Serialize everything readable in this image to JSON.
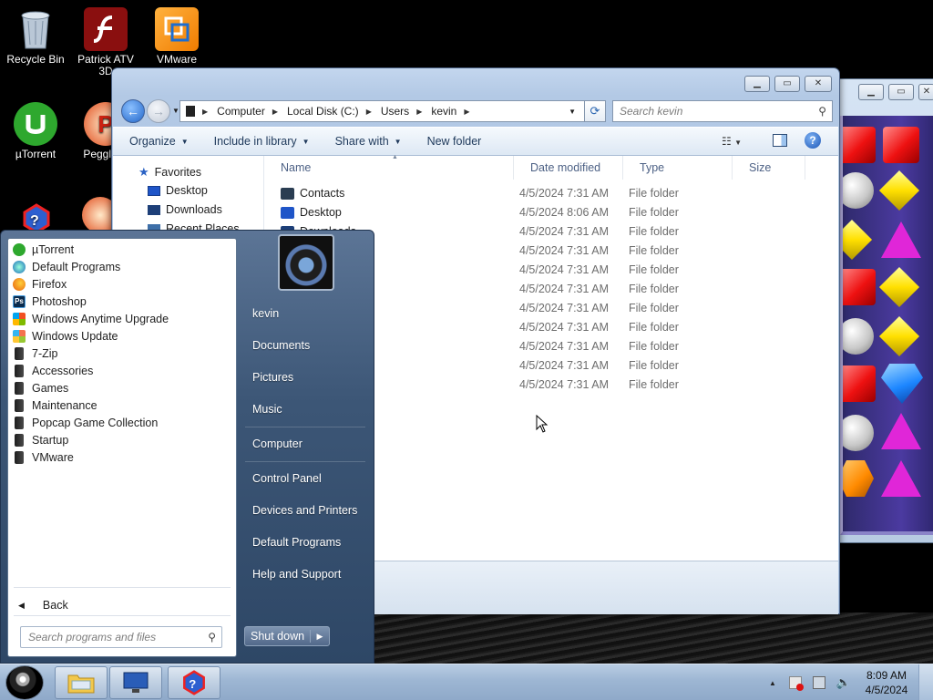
{
  "desktop": {
    "icons": [
      {
        "label": "Recycle Bin"
      },
      {
        "label": "Patrick ATV 3D"
      },
      {
        "label": "VMware"
      },
      {
        "label": "µTorrent"
      },
      {
        "label": "Peggle D"
      }
    ]
  },
  "explorer": {
    "breadcrumb": [
      "Computer",
      "Local Disk (C:)",
      "Users",
      "kevin"
    ],
    "search_placeholder": "Search kevin",
    "toolbar": {
      "organize": "Organize",
      "include_in_library": "Include in library",
      "share_with": "Share with",
      "new_folder": "New folder"
    },
    "nav_pane": {
      "favorites": "Favorites",
      "items": [
        "Desktop",
        "Downloads",
        "Recent Places"
      ]
    },
    "columns": {
      "name": "Name",
      "date_modified": "Date modified",
      "type": "Type",
      "size": "Size"
    },
    "files": [
      {
        "name": "Contacts",
        "date": "4/5/2024 7:31 AM",
        "type": "File folder"
      },
      {
        "name": "Desktop",
        "date": "4/5/2024 8:06 AM",
        "type": "File folder"
      },
      {
        "name": "Downloads",
        "date": "4/5/2024 7:31 AM",
        "type": "File folder"
      },
      {
        "name": "",
        "date": "4/5/2024 7:31 AM",
        "type": "File folder"
      },
      {
        "name": "",
        "date": "4/5/2024 7:31 AM",
        "type": "File folder"
      },
      {
        "name": "",
        "date": "4/5/2024 7:31 AM",
        "type": "File folder"
      },
      {
        "name": "",
        "date": "4/5/2024 7:31 AM",
        "type": "File folder"
      },
      {
        "name": "",
        "date": "4/5/2024 7:31 AM",
        "type": "File folder"
      },
      {
        "name": "",
        "date": "4/5/2024 7:31 AM",
        "type": "File folder"
      },
      {
        "name": "",
        "date": "4/5/2024 7:31 AM",
        "type": "File folder"
      },
      {
        "name": "",
        "date": "4/5/2024 7:31 AM",
        "type": "File folder"
      }
    ]
  },
  "start_menu": {
    "programs": [
      {
        "label": "µTorrent",
        "icon": "utorrent-icon"
      },
      {
        "label": "Default Programs",
        "icon": "default-programs-icon"
      },
      {
        "label": "Firefox",
        "icon": "firefox-icon"
      },
      {
        "label": "Photoshop",
        "icon": "photoshop-icon"
      },
      {
        "label": "Windows Anytime Upgrade",
        "icon": "windows-icon"
      },
      {
        "label": "Windows Update",
        "icon": "windows-update-icon"
      },
      {
        "label": "7-Zip",
        "icon": "folder-icon"
      },
      {
        "label": "Accessories",
        "icon": "folder-icon"
      },
      {
        "label": "Games",
        "icon": "folder-icon"
      },
      {
        "label": "Maintenance",
        "icon": "folder-icon"
      },
      {
        "label": "Popcap Game Collection",
        "icon": "folder-icon"
      },
      {
        "label": "Startup",
        "icon": "folder-icon"
      },
      {
        "label": "VMware",
        "icon": "folder-icon"
      }
    ],
    "back_label": "Back",
    "search_placeholder": "Search programs and files",
    "right_items": {
      "user": "kevin",
      "documents": "Documents",
      "pictures": "Pictures",
      "music": "Music",
      "computer": "Computer",
      "control_panel": "Control Panel",
      "devices_printers": "Devices and Printers",
      "default_programs": "Default Programs",
      "help_support": "Help and Support"
    },
    "shutdown_label": "Shut down"
  },
  "taskbar": {
    "time": "8:09 AM",
    "date": "4/5/2024"
  },
  "colors": {
    "accent": "#1e395b",
    "start_menu_bg": "#3c5676",
    "taskbar_bg": "#9db6d3"
  }
}
